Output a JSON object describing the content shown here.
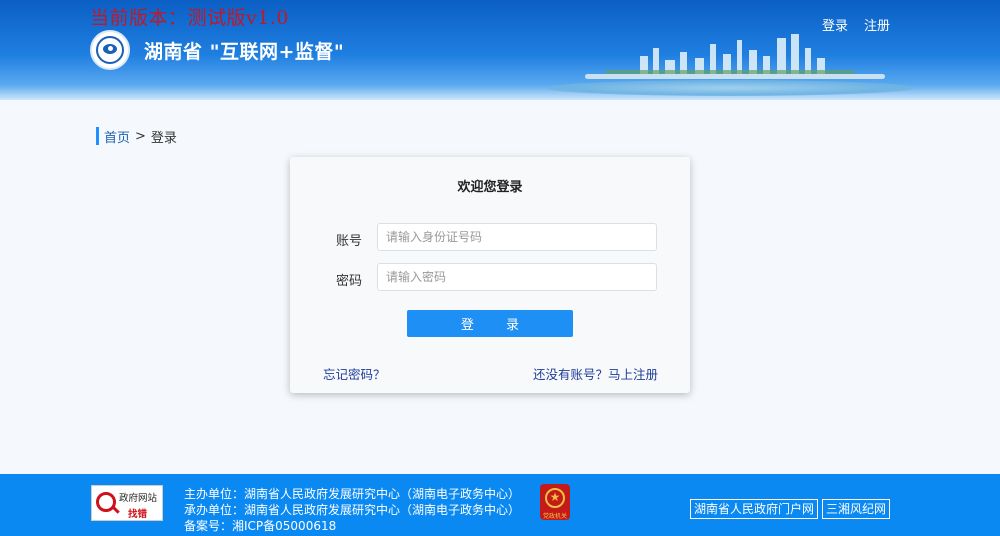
{
  "header": {
    "version": "当前版本：测试版v1.0",
    "title": "湖南省 \"互联网+监督\"",
    "nav": {
      "login": "登录",
      "register": "注册"
    }
  },
  "breadcrumb": {
    "home": "首页",
    "separator": ">",
    "current": "登录"
  },
  "login": {
    "title": "欢迎您登录",
    "account_label": "账号",
    "account_placeholder": "请输入身份证号码",
    "account_value": "",
    "password_label": "密码",
    "password_placeholder": "请输入密码",
    "password_value": "",
    "submit": "登 录",
    "forgot": "忘记密码？",
    "register": "还没有账号？马上注册"
  },
  "footer": {
    "gov_badge_top": "政府网站",
    "gov_badge_bottom": "找错",
    "sponsor": "主办单位：湖南省人民政府发展研究中心（湖南电子政务中心）",
    "organizer": "承办单位：湖南省人民政府发展研究中心（湖南电子政务中心）",
    "icp": "备案号：湘ICP备05000618",
    "party_badge_label": "党政机关",
    "links": [
      "湖南省人民政府门户网",
      "三湘风纪网"
    ]
  },
  "colors": {
    "header_blue": "#0b5fc4",
    "button_blue": "#1e90f5",
    "footer_blue": "#0a89f3",
    "version_red": "#c0182a"
  }
}
